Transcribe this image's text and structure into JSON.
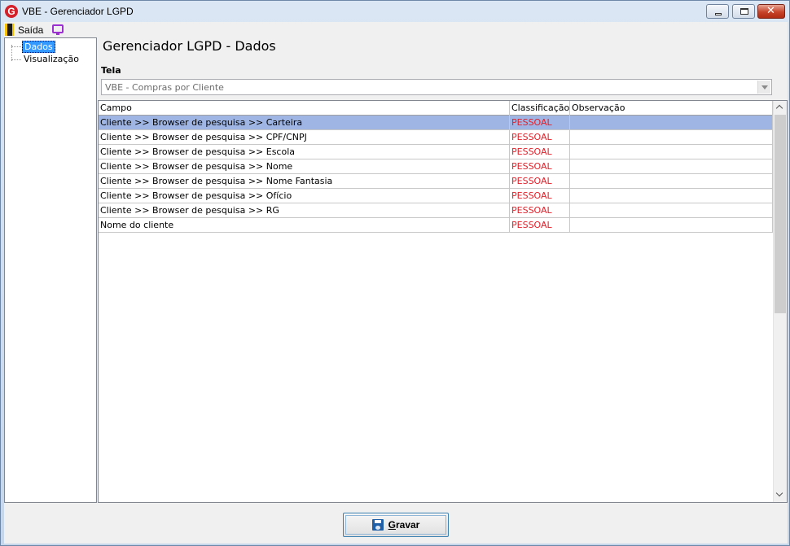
{
  "window": {
    "title": "VBE - Gerenciador LGPD",
    "app_icon": "G"
  },
  "menu": {
    "exit_label": "Saída"
  },
  "tree": {
    "items": [
      {
        "label": "Dados",
        "selected": true
      },
      {
        "label": "Visualização",
        "selected": false
      }
    ]
  },
  "main": {
    "title": "Gerenciador LGPD - Dados",
    "tela_label": "Tela",
    "tela_value": "VBE - Compras por Cliente"
  },
  "grid": {
    "columns": [
      "Campo",
      "Classificação",
      "Observação"
    ],
    "rows": [
      {
        "campo": "Cliente >> Browser de pesquisa >> Carteira",
        "classificacao": "PESSOAL",
        "observacao": ""
      },
      {
        "campo": "Cliente >> Browser de pesquisa >> CPF/CNPJ",
        "classificacao": "PESSOAL",
        "observacao": ""
      },
      {
        "campo": "Cliente >> Browser de pesquisa >> Escola",
        "classificacao": "PESSOAL",
        "observacao": ""
      },
      {
        "campo": "Cliente >> Browser de pesquisa >> Nome",
        "classificacao": "PESSOAL",
        "observacao": ""
      },
      {
        "campo": "Cliente >> Browser de pesquisa >> Nome Fantasia",
        "classificacao": "PESSOAL",
        "observacao": ""
      },
      {
        "campo": "Cliente >> Browser de pesquisa >> Ofício",
        "classificacao": "PESSOAL",
        "observacao": ""
      },
      {
        "campo": "Cliente >> Browser de pesquisa >> RG",
        "classificacao": "PESSOAL",
        "observacao": ""
      },
      {
        "campo": "Nome do cliente",
        "classificacao": "PESSOAL",
        "observacao": ""
      }
    ]
  },
  "footer": {
    "save_label_first": "G",
    "save_label_rest": "ravar"
  },
  "colors": {
    "selected_row": "#9fb6e4",
    "classification_text": "#e0202a",
    "tree_selection": "#3399ff"
  }
}
